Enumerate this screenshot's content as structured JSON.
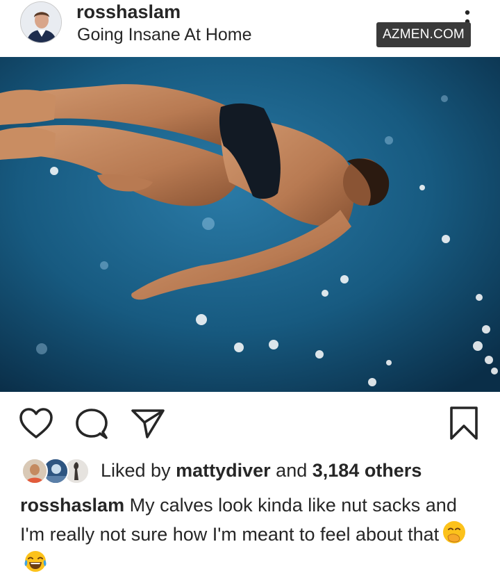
{
  "post": {
    "username": "rosshaslam",
    "location": "Going Insane At Home",
    "watermark": "AZMEN.COM"
  },
  "photo": {
    "alt_icon": "diver-photo"
  },
  "actions": {
    "like_icon": "heart-icon",
    "comment_icon": "comment-icon",
    "share_icon": "paper-plane-icon",
    "save_icon": "bookmark-icon"
  },
  "likes": {
    "prefix": "Liked by",
    "liker": "mattydiver",
    "joiner": "and",
    "others": "3,184 others"
  },
  "caption": {
    "author": "rosshaslam",
    "text": "My calves look kinda like nut sacks and I'm really not sure how I'm meant to feel about that",
    "emojis": [
      "hand-over-mouth-emoji",
      "tears-of-joy-emoji"
    ]
  },
  "colors": {
    "text": "#262626",
    "photo_blue": "#1a5f86",
    "watermark_bg": "#3a3a3a"
  }
}
